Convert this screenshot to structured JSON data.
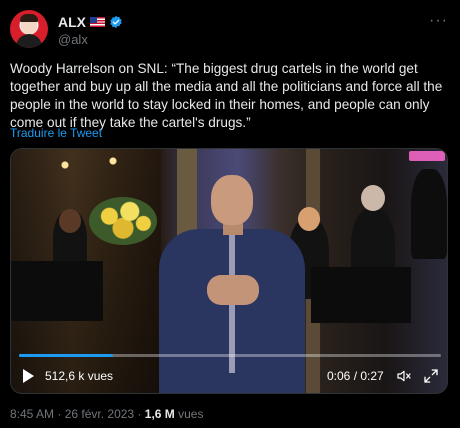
{
  "author": {
    "name": "ALX",
    "handle": "@alx",
    "flag_icon": "us-flag-icon",
    "verified_icon": "verified-badge-icon",
    "avatar_color": "#d81e2a"
  },
  "more_icon": "more-options-icon",
  "more_glyph": "···",
  "tweet": {
    "text": "Woody Harrelson on SNL: “The biggest drug cartels in the world get together and buy up all the media and all the politicians and force all the people in the world to stay locked in their homes, and people can only come out if they take the cartel's drugs.”",
    "translate_link": "Traduire le Tweet"
  },
  "video": {
    "views": "512,6 k vues",
    "time": "0:06 / 0:27",
    "progress": 0.222,
    "play_icon": "play-icon",
    "mute_icon": "muted-speaker-icon",
    "fullscreen_icon": "fullscreen-icon",
    "accent": "#1d9bf0"
  },
  "meta": {
    "time": "8:45 AM",
    "sep1": " · ",
    "date": "26 févr. 2023",
    "sep2": " · ",
    "views_count": "1,6 M",
    "views_label": " vues"
  },
  "colors": {
    "background": "#000000",
    "text": "#e7e9ea",
    "secondary": "#71767b",
    "link": "#1d9bf0"
  }
}
